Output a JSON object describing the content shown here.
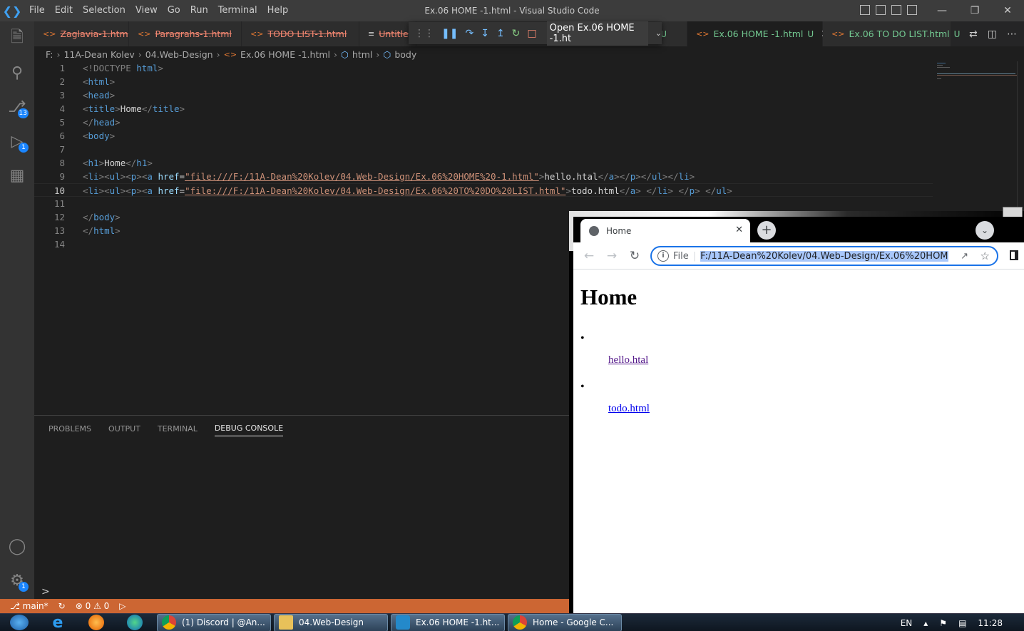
{
  "titlebar": {
    "menu": [
      "File",
      "Edit",
      "Selection",
      "View",
      "Go",
      "Run",
      "Terminal",
      "Help"
    ],
    "window_title": "Ex.06 HOME -1.html - Visual Studio Code"
  },
  "activity": {
    "scm_badge": "13",
    "debug_badge": "1",
    "settings_badge": "1"
  },
  "tabs": [
    {
      "label": "Zaglavia-1.htm",
      "state": "deleted"
    },
    {
      "label": "Paragrahs-1.html",
      "state": "deleted"
    },
    {
      "label": "TODO LIST-1.html",
      "state": "deleted"
    },
    {
      "label": "Untitle",
      "state": "deleted"
    },
    {
      "label": "U",
      "state": "untracked"
    },
    {
      "label": "Ex.06 HOME -1.html",
      "state": "active",
      "marker": "U"
    },
    {
      "label": "Ex.06 TO DO LIST.html",
      "state": "untracked",
      "marker": "U"
    }
  ],
  "debug": {
    "config": "Open Ex.06 HOME -1.ht"
  },
  "breadcrumb": [
    "F:",
    "11A-Dean Kolev",
    "04.Web-Design",
    "Ex.06 HOME -1.html",
    "html",
    "body"
  ],
  "code": {
    "line_numbers": [
      "1",
      "2",
      "3",
      "4",
      "5",
      "6",
      "7",
      "8",
      "9",
      "10",
      "11",
      "12",
      "13",
      "14"
    ],
    "l1_kw": "<!DOCTYPE",
    "l1_tag": "html",
    "l1_end": ">",
    "html": "html",
    "head": "head",
    "title": "title",
    "title_text": "Home",
    "body": "body",
    "h1": "h1",
    "h1_text": "Home",
    "l9_href": "\"file:///F:/11A-Dean%20Kolev/04.Web-Design/Ex.06%20HOME%20-1.html\"",
    "l9_text": "hello.htal",
    "l10_href": "\"file:///F:/11A-Dean%20Kolev/04.Web-Design/Ex.06%20TO%20DO%20LIST.html\"",
    "l10_text": "todo.html"
  },
  "panel": {
    "tabs": [
      "PROBLEMS",
      "OUTPUT",
      "TERMINAL",
      "DEBUG CONSOLE"
    ],
    "active_tab": "DEBUG CONSOLE",
    "prompt": ">"
  },
  "status": {
    "branch": "main*",
    "errors": "0",
    "warnings": "0"
  },
  "browser": {
    "tab_title": "Home",
    "scheme": "File",
    "url": "F:/11A-Dean%20Kolev/04.Web-Design/Ex.06%20HOME%",
    "page_heading": "Home",
    "link1": "hello.htal",
    "link2": "todo.html"
  },
  "taskbar": {
    "windows": [
      "(1) Discord | @An...",
      "04.Web-Design",
      "Ex.06 HOME -1.ht...",
      "Home - Google C..."
    ],
    "lang": "EN",
    "time": "11:28"
  },
  "colors": {
    "status_bg": "#cc6633",
    "activity_bg": "#333333",
    "editor_bg": "#1e1e1e",
    "accent": "#1a73e8"
  }
}
